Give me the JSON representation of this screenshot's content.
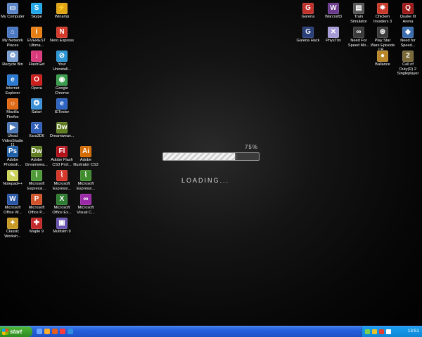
{
  "desktop": {
    "left_icons": [
      {
        "label": "My Computer",
        "icon": "computer-icon",
        "color": "#5d86c8",
        "glyph": "▭"
      },
      {
        "label": "Skype",
        "icon": "skype-icon",
        "color": "#21a7e8",
        "glyph": "S"
      },
      {
        "label": "Winamp",
        "icon": "winamp-icon",
        "color": "#e0a515",
        "glyph": "⚡"
      },
      {
        "label": "My Network Places",
        "icon": "network-icon",
        "color": "#4b78c2",
        "glyph": "⌂"
      },
      {
        "label": "EVEREST Ultima...",
        "icon": "everest-icon",
        "color": "#e77f14",
        "glyph": "i"
      },
      {
        "label": "Nero Express",
        "icon": "nero-icon",
        "color": "#d43b2b",
        "glyph": "N"
      },
      {
        "label": "Recycle Bin",
        "icon": "recycle-bin-icon",
        "color": "#7a9fd0",
        "glyph": "♻"
      },
      {
        "label": "FlashGet",
        "icon": "flashget-icon",
        "color": "#d93a7b",
        "glyph": "↓"
      },
      {
        "label": "Your Uninstall...",
        "icon": "uninstaller-icon",
        "color": "#2c96d6",
        "glyph": "⊘"
      },
      {
        "label": "Internet Explorer",
        "icon": "internet-explorer-icon",
        "color": "#2b79d1",
        "glyph": "e"
      },
      {
        "label": "Opera",
        "icon": "opera-icon",
        "color": "#cc1d1d",
        "glyph": "O"
      },
      {
        "label": "Google Chrome",
        "icon": "chrome-icon",
        "color": "#3a9d4c",
        "glyph": "◉"
      },
      {
        "label": "Mozilla Firefox",
        "icon": "firefox-icon",
        "color": "#e06a16",
        "glyph": "☼"
      },
      {
        "label": "Safari",
        "icon": "safari-icon",
        "color": "#3b8fd6",
        "glyph": "✪"
      },
      {
        "label": "IETester",
        "icon": "ietester-icon",
        "color": "#2f66c4",
        "glyph": "e"
      },
      {
        "label": "Ulead VideoStudio 11",
        "icon": "videostudio-icon",
        "color": "#4d79b8",
        "glyph": "▶"
      },
      {
        "label": "Xara3D6",
        "icon": "xara3d-icon",
        "color": "#2f5fba",
        "glyph": "X"
      },
      {
        "label": "Dreamweav...",
        "icon": "dreamweaver-icon",
        "color": "#5f7d20",
        "glyph": "Dw"
      },
      {
        "label": "Adobe Photosh...",
        "icon": "photoshop-icon",
        "color": "#1f5fa8",
        "glyph": "Ps"
      },
      {
        "label": "Adobe Dreamwea...",
        "icon": "dreamweaver-icon",
        "color": "#5f7d20",
        "glyph": "Dw"
      },
      {
        "label": "Adobe Flash CS3 Prof...",
        "icon": "flash-icon",
        "color": "#b3121b",
        "glyph": "Fl"
      },
      {
        "label": "Adobe Illustrator CS3",
        "icon": "illustrator-icon",
        "color": "#d46b00",
        "glyph": "Ai"
      },
      {
        "label": "Notepad++",
        "icon": "notepadpp-icon",
        "color": "#cbd35a",
        "glyph": "✎"
      },
      {
        "label": "Microsoft Expressi...",
        "icon": "expression-icon",
        "color": "#4f9b3a",
        "glyph": "⌇"
      },
      {
        "label": "Microsoft Expressi...",
        "icon": "expression-icon",
        "color": "#d6382b",
        "glyph": "⌇"
      },
      {
        "label": "Microsoft Expressi...",
        "icon": "expression-icon",
        "color": "#3f8d2d",
        "glyph": "⌇"
      },
      {
        "label": "Microsoft Office W...",
        "icon": "word-icon",
        "color": "#2957a6",
        "glyph": "W"
      },
      {
        "label": "Microsoft Office P...",
        "icon": "powerpoint-icon",
        "color": "#d0532a",
        "glyph": "P"
      },
      {
        "label": "Microsoft Office Ex...",
        "icon": "excel-icon",
        "color": "#2f7d32",
        "glyph": "X"
      },
      {
        "label": "Microsoft Visual C...",
        "icon": "visual-studio-icon",
        "color": "#9b2aa8",
        "glyph": "∞"
      },
      {
        "label": "Classic Worksh...",
        "icon": "classic-workshop-icon",
        "color": "#c79a25",
        "glyph": "✦"
      },
      {
        "label": "Maple 9",
        "icon": "maple-icon",
        "color": "#c22a2a",
        "glyph": "✚"
      },
      {
        "label": "Multisim 9",
        "icon": "multisim-icon",
        "color": "#6a55b0",
        "glyph": "▣"
      }
    ],
    "right_icons": [
      {
        "label": "Garena",
        "icon": "garena-icon",
        "color": "#c0312c",
        "glyph": "G"
      },
      {
        "label": "Warcraft3",
        "icon": "warcraft-icon",
        "color": "#6b3a8c",
        "glyph": "W"
      },
      {
        "label": "Train Simulator",
        "icon": "train-simulator-icon",
        "color": "#555",
        "glyph": "▤"
      },
      {
        "label": "Chicken Invaders 3",
        "icon": "chicken-invaders-icon",
        "color": "#c73a2a",
        "glyph": "✸"
      },
      {
        "label": "Quake III Arena",
        "icon": "quake-icon",
        "color": "#a01a1a",
        "glyph": "Q"
      },
      {
        "label": "Garena Hack",
        "icon": "garena-hack-icon",
        "color": "#2a3f7a",
        "glyph": "G"
      },
      {
        "label": "PhysTrix",
        "icon": "phystrix-icon",
        "color": "#a79bd8",
        "glyph": "✕"
      },
      {
        "label": "Need For Speed Mo...",
        "icon": "nfs-icon",
        "color": "#3a3a3a",
        "glyph": "∞"
      },
      {
        "label": "Play Star Wars Episode I R...",
        "icon": "star-wars-icon",
        "color": "#3d3d3d",
        "glyph": "⊛"
      },
      {
        "label": "Need for Speed...",
        "icon": "nfs-icon",
        "color": "#3d6fb0",
        "glyph": "◆"
      },
      {
        "label": "Ballance",
        "icon": "ballance-icon",
        "color": "#b8872a",
        "glyph": "●"
      },
      {
        "label": "Call of Duty(R) 2 Singleplayer",
        "icon": "call-of-duty-icon",
        "color": "#7a6a3a",
        "glyph": "2"
      }
    ]
  },
  "loading": {
    "percent_text": "75%",
    "progress_fraction": 0.75,
    "label": "LOADING..."
  },
  "taskbar": {
    "start_label": "start",
    "clock": "13:51",
    "quick_launch": [
      "quick-launch-icon",
      "quick-launch-icon",
      "quick-launch-icon",
      "quick-launch-icon",
      "quick-launch-icon"
    ],
    "tray": [
      "tray-icon",
      "tray-icon",
      "tray-icon",
      "tray-icon"
    ]
  }
}
